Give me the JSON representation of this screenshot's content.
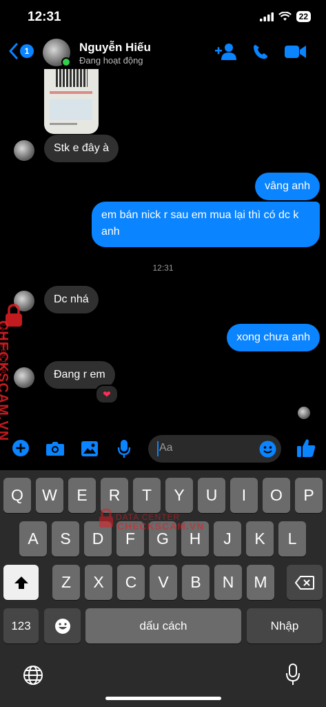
{
  "status_bar": {
    "time": "12:31",
    "battery": "22"
  },
  "header": {
    "back_badge": "1",
    "contact_name": "Nguyễn Hiếu",
    "contact_status": "Đang hoạt động"
  },
  "messages": [
    {
      "id": "m1",
      "side": "in",
      "text": "Stk e đây à"
    },
    {
      "id": "m2",
      "side": "out",
      "text": "vâng anh"
    },
    {
      "id": "m3",
      "side": "out",
      "text": "em bán nick r sau em mua lại thì có dc k anh"
    },
    {
      "id": "m4",
      "side": "in",
      "text": "Dc nhá"
    },
    {
      "id": "m5",
      "side": "out",
      "text": "xong chưa anh"
    },
    {
      "id": "m6",
      "side": "in",
      "text": "Đang r em",
      "reaction": "❤"
    }
  ],
  "timestamp": "12:31",
  "watermark": {
    "brand": "CHECKSCAM.VN",
    "tagline": "DATA CENTER"
  },
  "composer": {
    "placeholder": "Aa"
  },
  "keyboard": {
    "row1": [
      "Q",
      "W",
      "E",
      "R",
      "T",
      "Y",
      "U",
      "I",
      "O",
      "P"
    ],
    "row2": [
      "A",
      "S",
      "D",
      "F",
      "G",
      "H",
      "J",
      "K",
      "L"
    ],
    "row3": [
      "Z",
      "X",
      "C",
      "V",
      "B",
      "N",
      "M"
    ],
    "numbers_key": "123",
    "space_key": "dấu cách",
    "return_key": "Nhập"
  },
  "colors": {
    "accent": "#0a84ff",
    "incoming_bubble": "#303030",
    "watermark": "#e31e24"
  },
  "icons": [
    "back-chevron-icon",
    "add-person-icon",
    "phone-icon",
    "video-icon",
    "plus-icon",
    "camera-icon",
    "gallery-icon",
    "mic-icon",
    "emoji-icon",
    "like-icon",
    "shift-icon",
    "backspace-icon",
    "globe-icon"
  ]
}
